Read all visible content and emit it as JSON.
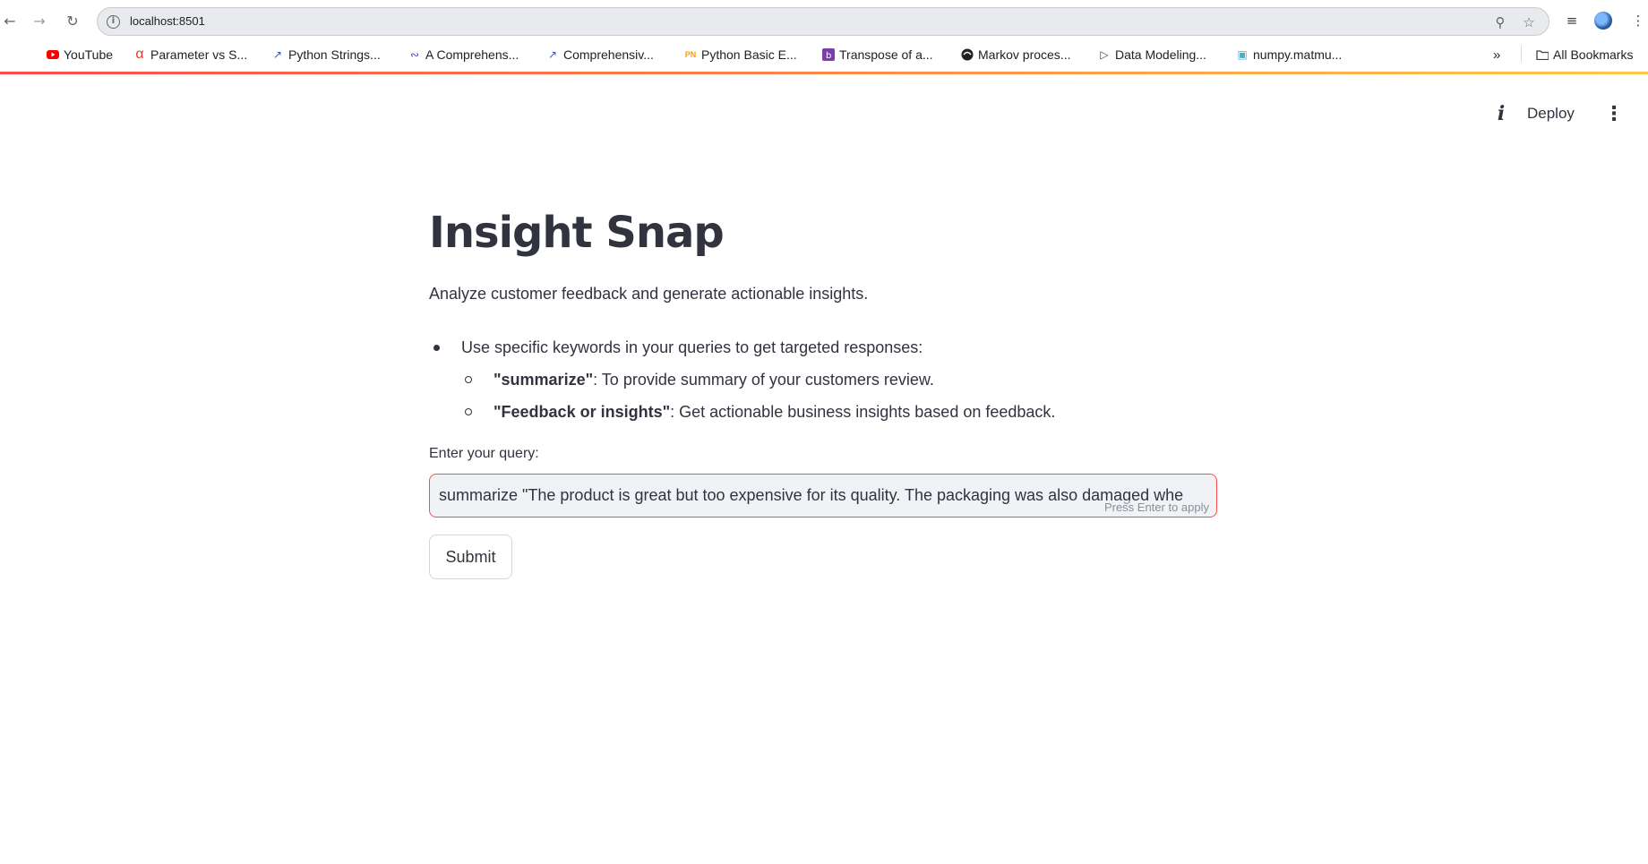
{
  "browser": {
    "url": "localhost:8501",
    "bookmarks": [
      {
        "label": "YouTube",
        "icon": "youtube-icon",
        "color": "#ff0000"
      },
      {
        "label": "Parameter vs S...",
        "icon": "alpha-icon",
        "color": "#e53935"
      },
      {
        "label": "Python Strings...",
        "icon": "trend-icon",
        "color": "#3f51b5"
      },
      {
        "label": "A Comprehens...",
        "icon": "wave-icon",
        "color": "#3f51b5"
      },
      {
        "label": "Comprehensiv...",
        "icon": "trend-icon",
        "color": "#3f51b5"
      },
      {
        "label": "Python Basic E...",
        "icon": "pn-icon",
        "color": "#ff9800"
      },
      {
        "label": "Transpose of a...",
        "icon": "bootstrap-icon",
        "color": "#7b3fa8"
      },
      {
        "label": "Markov proces...",
        "icon": "globe-icon",
        "color": "#202124"
      },
      {
        "label": "Data Modeling...",
        "icon": "play-icon",
        "color": "#3c4043"
      },
      {
        "label": "numpy.matmu...",
        "icon": "cube-icon",
        "color": "#4dabcf"
      }
    ],
    "all_bookmarks_label": "All Bookmarks"
  },
  "header": {
    "deploy_label": "Deploy"
  },
  "main": {
    "title": "Insight Snap",
    "subtitle": "Analyze customer feedback and generate actionable insights.",
    "bullet_intro": "Use specific keywords in your queries to get targeted responses:",
    "sub_bullets": [
      {
        "keyword": "\"summarize\"",
        "text": ": To provide summary of your customers review."
      },
      {
        "keyword": "\"Feedback or insights\"",
        "text": ": Get actionable business insights based on feedback."
      }
    ],
    "query_label": "Enter your query:",
    "query_value": "summarize \"The product is great but too expensive for its quality. The packaging was also damaged whe",
    "query_hint": "Press Enter to apply",
    "submit_label": "Submit"
  },
  "colors": {
    "accent": "#ff4b4b",
    "text": "#31333f",
    "input_bg": "#f0f2f6"
  }
}
